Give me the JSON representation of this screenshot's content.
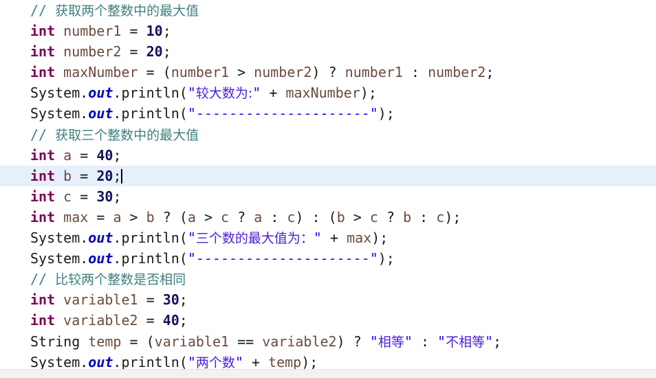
{
  "editor": {
    "language": "Java",
    "background_color": "#ffffff",
    "current_line_highlight_color": "#e6effc",
    "status_strip_color": "#f2f2f2",
    "caret_line_index": 8,
    "colors": {
      "comment": "#3f7f7f",
      "keyword": "#7f0055",
      "string": "#2a00ff",
      "cjk_string": "#4b1fd6",
      "number": "#14125c",
      "static_field": "#0000c0",
      "identifier": "#6a4a3c",
      "plain": "#2b2b2b"
    }
  },
  "code": {
    "lines": [
      {
        "index": 0,
        "tokens": [
          {
            "t": "comment",
            "v": "// "
          },
          {
            "t": "comment_cjk",
            "v": "获取两个整数中的最大值"
          }
        ]
      },
      {
        "index": 1,
        "tokens": [
          {
            "t": "keyword",
            "v": "int"
          },
          {
            "t": "plain",
            "v": " "
          },
          {
            "t": "ident",
            "v": "number1"
          },
          {
            "t": "plain",
            "v": " "
          },
          {
            "t": "op",
            "v": "="
          },
          {
            "t": "plain",
            "v": " "
          },
          {
            "t": "number",
            "v": "10"
          },
          {
            "t": "punct",
            "v": ";"
          }
        ]
      },
      {
        "index": 2,
        "tokens": [
          {
            "t": "keyword",
            "v": "int"
          },
          {
            "t": "plain",
            "v": " "
          },
          {
            "t": "ident",
            "v": "number2"
          },
          {
            "t": "plain",
            "v": " "
          },
          {
            "t": "op",
            "v": "="
          },
          {
            "t": "plain",
            "v": " "
          },
          {
            "t": "number",
            "v": "20"
          },
          {
            "t": "punct",
            "v": ";"
          }
        ]
      },
      {
        "index": 3,
        "tokens": [
          {
            "t": "keyword",
            "v": "int"
          },
          {
            "t": "plain",
            "v": " "
          },
          {
            "t": "ident",
            "v": "maxNumber"
          },
          {
            "t": "plain",
            "v": " "
          },
          {
            "t": "op",
            "v": "="
          },
          {
            "t": "plain",
            "v": " "
          },
          {
            "t": "punct",
            "v": "("
          },
          {
            "t": "ident",
            "v": "number1"
          },
          {
            "t": "plain",
            "v": " "
          },
          {
            "t": "op",
            "v": ">"
          },
          {
            "t": "plain",
            "v": " "
          },
          {
            "t": "ident",
            "v": "number2"
          },
          {
            "t": "punct",
            "v": ")"
          },
          {
            "t": "plain",
            "v": " "
          },
          {
            "t": "op",
            "v": "?"
          },
          {
            "t": "plain",
            "v": " "
          },
          {
            "t": "ident",
            "v": "number1"
          },
          {
            "t": "plain",
            "v": " "
          },
          {
            "t": "op",
            "v": ":"
          },
          {
            "t": "plain",
            "v": " "
          },
          {
            "t": "ident",
            "v": "number2"
          },
          {
            "t": "punct",
            "v": ";"
          }
        ]
      },
      {
        "index": 4,
        "tokens": [
          {
            "t": "type",
            "v": "System"
          },
          {
            "t": "punct",
            "v": "."
          },
          {
            "t": "field",
            "v": "out"
          },
          {
            "t": "punct",
            "v": "."
          },
          {
            "t": "type",
            "v": "println"
          },
          {
            "t": "punct",
            "v": "("
          },
          {
            "t": "string",
            "v": "\""
          },
          {
            "t": "string_cjk",
            "v": "较大数为:"
          },
          {
            "t": "string",
            "v": "\""
          },
          {
            "t": "plain",
            "v": " "
          },
          {
            "t": "op",
            "v": "+"
          },
          {
            "t": "plain",
            "v": " "
          },
          {
            "t": "ident",
            "v": "maxNumber"
          },
          {
            "t": "punct",
            "v": ");"
          }
        ]
      },
      {
        "index": 5,
        "tokens": [
          {
            "t": "type",
            "v": "System"
          },
          {
            "t": "punct",
            "v": "."
          },
          {
            "t": "field",
            "v": "out"
          },
          {
            "t": "punct",
            "v": "."
          },
          {
            "t": "type",
            "v": "println"
          },
          {
            "t": "punct",
            "v": "("
          },
          {
            "t": "string",
            "v": "\"---------------------\""
          },
          {
            "t": "punct",
            "v": ");"
          }
        ]
      },
      {
        "index": 6,
        "tokens": [
          {
            "t": "comment",
            "v": "// "
          },
          {
            "t": "comment_cjk",
            "v": "获取三个整数中的最大值"
          }
        ]
      },
      {
        "index": 7,
        "tokens": [
          {
            "t": "keyword",
            "v": "int"
          },
          {
            "t": "plain",
            "v": " "
          },
          {
            "t": "ident",
            "v": "a"
          },
          {
            "t": "plain",
            "v": " "
          },
          {
            "t": "op",
            "v": "="
          },
          {
            "t": "plain",
            "v": " "
          },
          {
            "t": "number",
            "v": "40"
          },
          {
            "t": "punct",
            "v": ";"
          }
        ]
      },
      {
        "index": 8,
        "current": true,
        "tokens": [
          {
            "t": "keyword",
            "v": "int"
          },
          {
            "t": "plain",
            "v": " "
          },
          {
            "t": "ident",
            "v": "b"
          },
          {
            "t": "plain",
            "v": " "
          },
          {
            "t": "op",
            "v": "="
          },
          {
            "t": "plain",
            "v": " "
          },
          {
            "t": "number",
            "v": "20"
          },
          {
            "t": "punct",
            "v": ";"
          },
          {
            "t": "caret",
            "v": ""
          }
        ]
      },
      {
        "index": 9,
        "tokens": [
          {
            "t": "keyword",
            "v": "int"
          },
          {
            "t": "plain",
            "v": " "
          },
          {
            "t": "ident",
            "v": "c"
          },
          {
            "t": "plain",
            "v": " "
          },
          {
            "t": "op",
            "v": "="
          },
          {
            "t": "plain",
            "v": " "
          },
          {
            "t": "number",
            "v": "30"
          },
          {
            "t": "punct",
            "v": ";"
          }
        ]
      },
      {
        "index": 10,
        "tokens": [
          {
            "t": "keyword",
            "v": "int"
          },
          {
            "t": "plain",
            "v": " "
          },
          {
            "t": "ident",
            "v": "max"
          },
          {
            "t": "plain",
            "v": " "
          },
          {
            "t": "op",
            "v": "="
          },
          {
            "t": "plain",
            "v": " "
          },
          {
            "t": "ident",
            "v": "a"
          },
          {
            "t": "plain",
            "v": " "
          },
          {
            "t": "op",
            "v": ">"
          },
          {
            "t": "plain",
            "v": " "
          },
          {
            "t": "ident",
            "v": "b"
          },
          {
            "t": "plain",
            "v": " "
          },
          {
            "t": "op",
            "v": "?"
          },
          {
            "t": "plain",
            "v": " "
          },
          {
            "t": "punct",
            "v": "("
          },
          {
            "t": "ident",
            "v": "a"
          },
          {
            "t": "plain",
            "v": " "
          },
          {
            "t": "op",
            "v": ">"
          },
          {
            "t": "plain",
            "v": " "
          },
          {
            "t": "ident",
            "v": "c"
          },
          {
            "t": "plain",
            "v": " "
          },
          {
            "t": "op",
            "v": "?"
          },
          {
            "t": "plain",
            "v": " "
          },
          {
            "t": "ident",
            "v": "a"
          },
          {
            "t": "plain",
            "v": " "
          },
          {
            "t": "op",
            "v": ":"
          },
          {
            "t": "plain",
            "v": " "
          },
          {
            "t": "ident",
            "v": "c"
          },
          {
            "t": "punct",
            "v": ")"
          },
          {
            "t": "plain",
            "v": " "
          },
          {
            "t": "op",
            "v": ":"
          },
          {
            "t": "plain",
            "v": " "
          },
          {
            "t": "punct",
            "v": "("
          },
          {
            "t": "ident",
            "v": "b"
          },
          {
            "t": "plain",
            "v": " "
          },
          {
            "t": "op",
            "v": ">"
          },
          {
            "t": "plain",
            "v": " "
          },
          {
            "t": "ident",
            "v": "c"
          },
          {
            "t": "plain",
            "v": " "
          },
          {
            "t": "op",
            "v": "?"
          },
          {
            "t": "plain",
            "v": " "
          },
          {
            "t": "ident",
            "v": "b"
          },
          {
            "t": "plain",
            "v": " "
          },
          {
            "t": "op",
            "v": ":"
          },
          {
            "t": "plain",
            "v": " "
          },
          {
            "t": "ident",
            "v": "c"
          },
          {
            "t": "punct",
            "v": ");"
          }
        ]
      },
      {
        "index": 11,
        "tokens": [
          {
            "t": "type",
            "v": "System"
          },
          {
            "t": "punct",
            "v": "."
          },
          {
            "t": "field",
            "v": "out"
          },
          {
            "t": "punct",
            "v": "."
          },
          {
            "t": "type",
            "v": "println"
          },
          {
            "t": "punct",
            "v": "("
          },
          {
            "t": "string",
            "v": "\""
          },
          {
            "t": "string_cjk",
            "v": "三个数的最大值为："
          },
          {
            "t": "string",
            "v": "\""
          },
          {
            "t": "plain",
            "v": " "
          },
          {
            "t": "op",
            "v": "+"
          },
          {
            "t": "plain",
            "v": " "
          },
          {
            "t": "ident",
            "v": "max"
          },
          {
            "t": "punct",
            "v": ");"
          }
        ]
      },
      {
        "index": 12,
        "tokens": [
          {
            "t": "type",
            "v": "System"
          },
          {
            "t": "punct",
            "v": "."
          },
          {
            "t": "field",
            "v": "out"
          },
          {
            "t": "punct",
            "v": "."
          },
          {
            "t": "type",
            "v": "println"
          },
          {
            "t": "punct",
            "v": "("
          },
          {
            "t": "string",
            "v": "\"---------------------\""
          },
          {
            "t": "punct",
            "v": ");"
          }
        ]
      },
      {
        "index": 13,
        "tokens": [
          {
            "t": "comment",
            "v": "// "
          },
          {
            "t": "comment_cjk",
            "v": "比较两个整数是否相同"
          }
        ]
      },
      {
        "index": 14,
        "tokens": [
          {
            "t": "keyword",
            "v": "int"
          },
          {
            "t": "plain",
            "v": " "
          },
          {
            "t": "ident",
            "v": "variable1"
          },
          {
            "t": "plain",
            "v": " "
          },
          {
            "t": "op",
            "v": "="
          },
          {
            "t": "plain",
            "v": " "
          },
          {
            "t": "number",
            "v": "30"
          },
          {
            "t": "punct",
            "v": ";"
          }
        ]
      },
      {
        "index": 15,
        "tokens": [
          {
            "t": "keyword",
            "v": "int"
          },
          {
            "t": "plain",
            "v": " "
          },
          {
            "t": "ident",
            "v": "variable2"
          },
          {
            "t": "plain",
            "v": " "
          },
          {
            "t": "op",
            "v": "="
          },
          {
            "t": "plain",
            "v": " "
          },
          {
            "t": "number",
            "v": "40"
          },
          {
            "t": "punct",
            "v": ";"
          }
        ]
      },
      {
        "index": 16,
        "tokens": [
          {
            "t": "type",
            "v": "String"
          },
          {
            "t": "plain",
            "v": " "
          },
          {
            "t": "ident",
            "v": "temp"
          },
          {
            "t": "plain",
            "v": " "
          },
          {
            "t": "op",
            "v": "="
          },
          {
            "t": "plain",
            "v": " "
          },
          {
            "t": "punct",
            "v": "("
          },
          {
            "t": "ident",
            "v": "variable1"
          },
          {
            "t": "plain",
            "v": " "
          },
          {
            "t": "op",
            "v": "=="
          },
          {
            "t": "plain",
            "v": " "
          },
          {
            "t": "ident",
            "v": "variable2"
          },
          {
            "t": "punct",
            "v": ")"
          },
          {
            "t": "plain",
            "v": " "
          },
          {
            "t": "op",
            "v": "?"
          },
          {
            "t": "plain",
            "v": " "
          },
          {
            "t": "string",
            "v": "\""
          },
          {
            "t": "string_cjk",
            "v": "相等"
          },
          {
            "t": "string",
            "v": "\""
          },
          {
            "t": "plain",
            "v": " "
          },
          {
            "t": "op",
            "v": ":"
          },
          {
            "t": "plain",
            "v": " "
          },
          {
            "t": "string",
            "v": "\""
          },
          {
            "t": "string_cjk",
            "v": "不相等"
          },
          {
            "t": "string",
            "v": "\""
          },
          {
            "t": "punct",
            "v": ";"
          }
        ]
      },
      {
        "index": 17,
        "tokens": [
          {
            "t": "type",
            "v": "System"
          },
          {
            "t": "punct",
            "v": "."
          },
          {
            "t": "field",
            "v": "out"
          },
          {
            "t": "punct",
            "v": "."
          },
          {
            "t": "type",
            "v": "println"
          },
          {
            "t": "punct",
            "v": "("
          },
          {
            "t": "string",
            "v": "\""
          },
          {
            "t": "string_cjk",
            "v": "两个数"
          },
          {
            "t": "string",
            "v": "\""
          },
          {
            "t": "plain",
            "v": " "
          },
          {
            "t": "op",
            "v": "+"
          },
          {
            "t": "plain",
            "v": " "
          },
          {
            "t": "ident",
            "v": "temp"
          },
          {
            "t": "punct",
            "v": ");"
          }
        ]
      }
    ]
  }
}
